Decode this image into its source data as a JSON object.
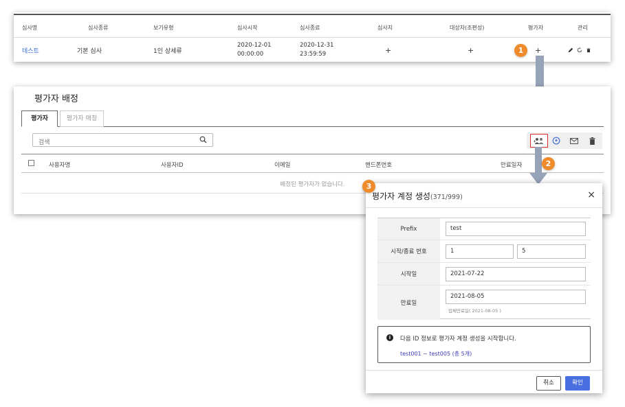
{
  "review_table": {
    "headers": [
      "심사명",
      "심사종류",
      "보기유형",
      "심사시작",
      "심사종료",
      "심사지",
      "대상자(조편성)",
      "평가자",
      "관리"
    ],
    "row": {
      "name": "테스트",
      "type": "기본 심사",
      "view_type": "1인 상세류",
      "start_date": "2020-12-01",
      "start_time": "00:00:00",
      "end_date": "2020-12-31",
      "end_time": "23:59:59",
      "sheet_add": "+",
      "target_add": "+",
      "evaluator_add": "+"
    }
  },
  "badges": [
    "1",
    "2",
    "3"
  ],
  "assign_panel": {
    "title": "평가자 배정",
    "tabs": [
      "평가자",
      "평가자 매칭"
    ],
    "search_placeholder": "검색",
    "table_headers": [
      "사용자명",
      "사용자ID",
      "이메일",
      "핸드폰번호",
      "만료일자"
    ],
    "empty_message": "배정된 평가자가 없습니다."
  },
  "modal": {
    "title": "평가자 계정 생성",
    "count": "(371/999)",
    "close_glyph": "×",
    "fields": {
      "prefix_label": "Prefix",
      "prefix_value": "test",
      "range_label": "시작/종료 번호",
      "range_start": "1",
      "range_end": "5",
      "start_label": "시작일",
      "start_value": "2021-07-22",
      "expire_label": "만료일",
      "expire_value": "2021-08-05",
      "expire_help": "업체만료일( 2021-08-05 )"
    },
    "info": {
      "message": "다음 ID 정보로 평가자 계정 생성을 시작합니다.",
      "range": "test001 ~ test005 (총 5개)"
    },
    "buttons": {
      "cancel": "취소",
      "confirm": "확인"
    }
  },
  "colors": {
    "badge": "#ef8b2a",
    "link": "#3f6fd8",
    "primary": "#4a6fe0",
    "highlight": "#d62b2b",
    "arrow": "#97a3b9"
  },
  "icons": [
    "pencil-icon",
    "refresh-icon",
    "trash-icon",
    "search-icon",
    "add-users-icon",
    "sync-icon",
    "mail-icon",
    "delete-icon",
    "info-icon",
    "close-icon"
  ]
}
